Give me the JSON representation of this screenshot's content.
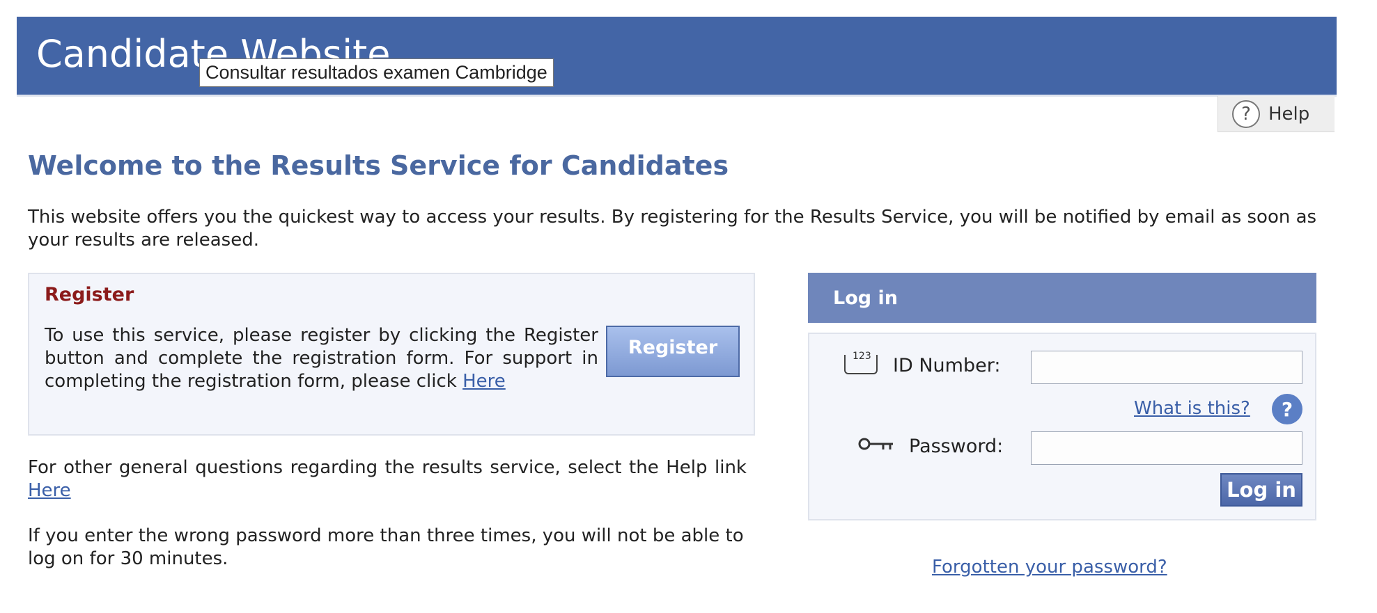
{
  "header": {
    "site_title": "Candidate Website",
    "tooltip": "Consultar resultados examen Cambridge"
  },
  "help_tab": {
    "label": "Help",
    "icon": "question-circle-icon"
  },
  "main": {
    "heading": "Welcome to the Results Service for Candidates",
    "intro": "This website offers you the quickest way to access your results. By registering for the Results Service, you will be notified by email as soon as your results are released.",
    "register": {
      "title": "Register",
      "text": "To use this service, please register by clicking the Register button and complete the registration form. For support in completing the registration form, please click ",
      "link": "Here",
      "button_label": "Register"
    },
    "general_questions": {
      "text": "For other general questions regarding the results service, select the Help link ",
      "link": "Here"
    },
    "lockout_notice": "If you enter the wrong password more than three times, you will not be able to log on for 30 minutes."
  },
  "login": {
    "header": "Log in",
    "id_label": "ID Number:",
    "id_icon_text": "123",
    "id_value": "",
    "what_is_this": "What is this?",
    "password_label": "Password:",
    "password_value": "",
    "button_label": "Log in",
    "forgot_link": "Forgotten your password?"
  },
  "colors": {
    "header_bg": "#4365a6",
    "heading": "#4a68a0",
    "register_title": "#8b1a1a",
    "login_header_bg": "#6f86bb",
    "link": "#3a5fa8"
  }
}
